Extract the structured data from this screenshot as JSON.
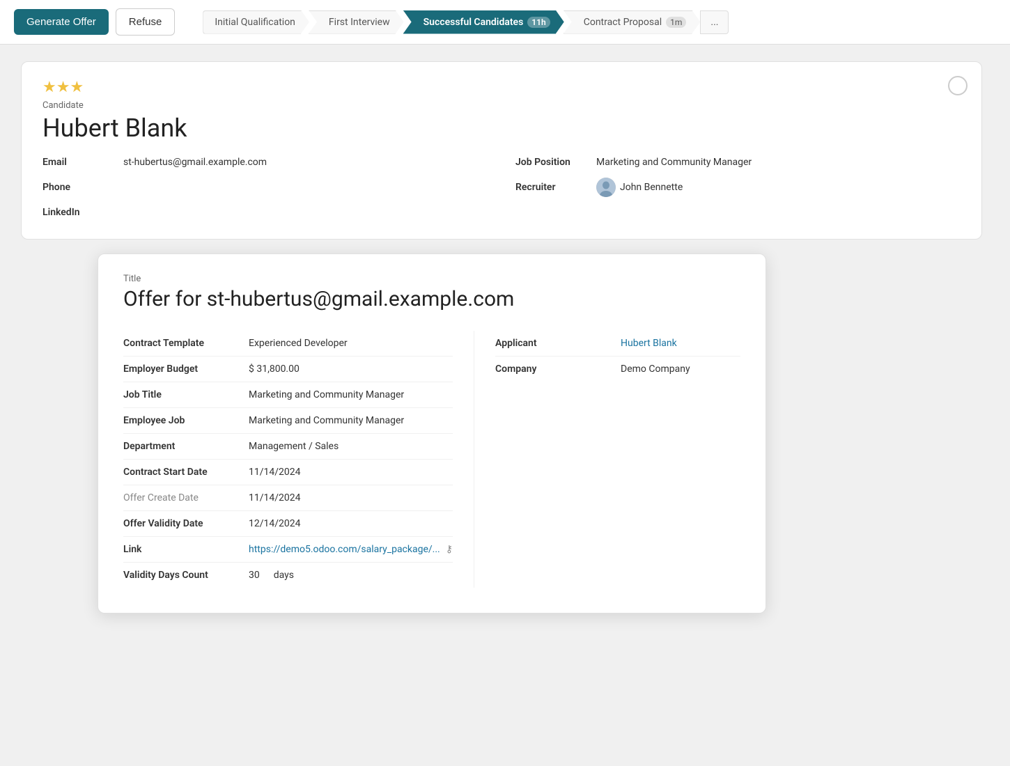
{
  "toolbar": {
    "generate_label": "Generate Offer",
    "refuse_label": "Refuse"
  },
  "pipeline": {
    "steps": [
      {
        "id": "initial",
        "label": "Initial Qualification",
        "badge": null,
        "active": false
      },
      {
        "id": "first",
        "label": "First Interview",
        "badge": null,
        "active": false
      },
      {
        "id": "successful",
        "label": "Successful Candidates",
        "badge": "11h",
        "active": true
      },
      {
        "id": "contract",
        "label": "Contract Proposal",
        "badge": "1m",
        "active": false
      }
    ],
    "ellipsis": "..."
  },
  "candidate": {
    "stars": "★★★",
    "label": "Candidate",
    "name": "Hubert Blank",
    "email_label": "Email",
    "email_value": "st-hubertus@gmail.example.com",
    "phone_label": "Phone",
    "phone_value": "",
    "linkedin_label": "LinkedIn",
    "linkedin_value": "",
    "job_position_label": "Job Position",
    "job_position_value": "Marketing and Community Manager",
    "recruiter_label": "Recruiter",
    "recruiter_name": "John Bennette"
  },
  "offer": {
    "title_label": "Title",
    "title_value": "Offer for st-hubertus@gmail.example.com",
    "fields_left": [
      {
        "label": "Contract Template",
        "value": "Experienced Developer",
        "muted": false
      },
      {
        "label": "Employer Budget",
        "value": "$ 31,800.00",
        "muted": false
      },
      {
        "label": "Job Title",
        "value": "Marketing and Community Manager",
        "muted": false
      },
      {
        "label": "Employee Job",
        "value": "Marketing and Community Manager",
        "muted": false
      },
      {
        "label": "Department",
        "value": "Management / Sales",
        "muted": false
      },
      {
        "label": "Contract Start Date",
        "value": "11/14/2024",
        "muted": false
      },
      {
        "label": "Offer Create Date",
        "value": "11/14/2024",
        "muted": true
      },
      {
        "label": "Offer Validity Date",
        "value": "12/14/2024",
        "muted": false
      },
      {
        "label": "Link",
        "value": "https://demo5.odoo.com/salary_package/...",
        "muted": false,
        "is_link": true
      },
      {
        "label": "Validity Days Count",
        "value": "30",
        "muted": false,
        "suffix": "days"
      }
    ],
    "fields_right": [
      {
        "label": "Applicant",
        "value": "Hubert Blank",
        "muted": false,
        "is_applicant_link": true
      },
      {
        "label": "Company",
        "value": "Demo Company",
        "muted": false
      }
    ]
  }
}
